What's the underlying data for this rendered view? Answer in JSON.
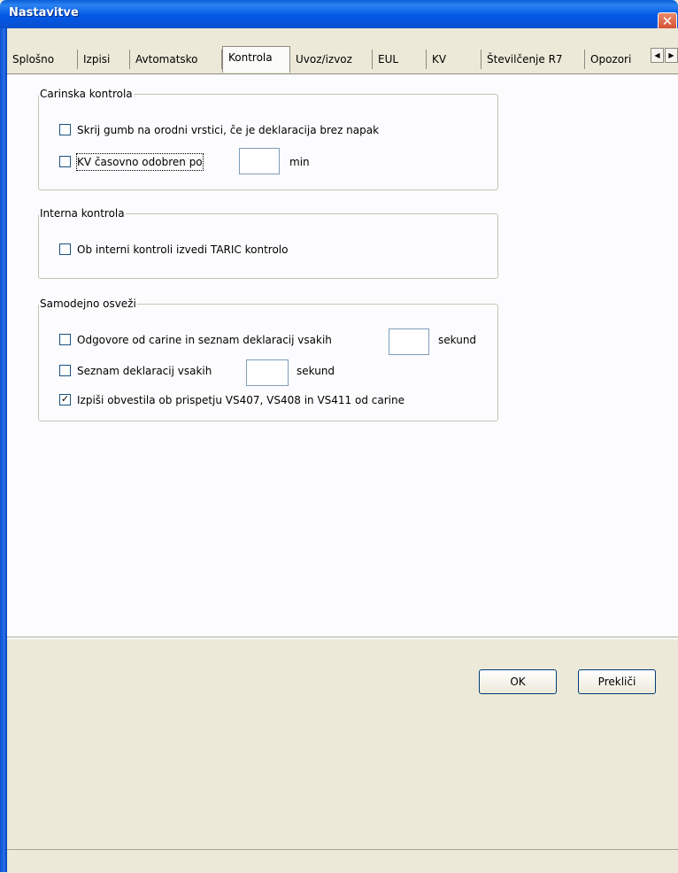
{
  "window": {
    "title": "Nastavitve",
    "close_label": "✕"
  },
  "tabs": [
    {
      "label": "Splošno"
    },
    {
      "label": "Izpisi"
    },
    {
      "label": "Avtomatsko"
    },
    {
      "label": "Kontrola",
      "active": true
    },
    {
      "label": "Uvoz/izvoz"
    },
    {
      "label": "EUL"
    },
    {
      "label": "KV"
    },
    {
      "label": "Številčenje R7"
    },
    {
      "label": "Opozori"
    }
  ],
  "tab_scroll": {
    "left_icon": "◀",
    "right_icon": "▶"
  },
  "groups": {
    "carinska": {
      "legend": "Carinska kontrola",
      "skrij_label": "Skrij gumb na orodni vrstici, če je deklaracija brez napak",
      "skrij_checked": false,
      "kv_label": "KV časovno odobren po",
      "kv_checked": false,
      "kv_value": "",
      "kv_unit": "min"
    },
    "interna": {
      "legend": "Interna kontrola",
      "taric_label": "Ob interni kontroli izvedi TARIC kontrolo",
      "taric_checked": false
    },
    "osvezi": {
      "legend": "Samodejno osveži",
      "odgovore_label": "Odgovore od carine in seznam deklaracij vsakih",
      "odgovore_checked": false,
      "odgovore_value": "",
      "odgovore_unit": "sekund",
      "seznam_label": "Seznam deklaracij vsakih",
      "seznam_checked": false,
      "seznam_value": "",
      "seznam_unit": "sekund",
      "izpisi_label": "Izpiši obvestila ob prispetju VS407, VS408 in VS411 od carine",
      "izpisi_checked": true
    }
  },
  "buttons": {
    "ok": "OK",
    "cancel": "Prekliči"
  },
  "checkmark": "✓"
}
